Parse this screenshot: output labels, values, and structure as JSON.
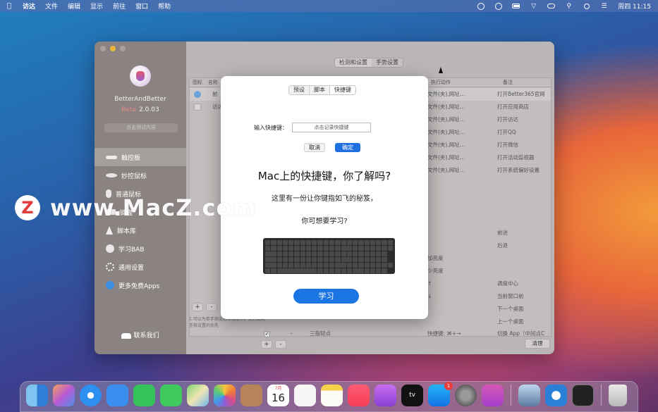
{
  "menubar": {
    "items": [
      "访达",
      "文件",
      "编辑",
      "显示",
      "前往",
      "窗口",
      "帮助"
    ],
    "clock": "周四 11:15"
  },
  "sidebar": {
    "app_name": "BetterAndBetter",
    "beta_label": "Beta",
    "version": "2.0.03",
    "faded_button": "点击测试内容",
    "items": [
      {
        "label": "触控板",
        "icon": "trackpad-icon"
      },
      {
        "label": "妙控鼠标",
        "icon": "magic-mouse-icon"
      },
      {
        "label": "普通鼠标",
        "icon": "mouse-icon"
      },
      {
        "label": "键盘",
        "icon": "keyboard-icon"
      },
      {
        "label": "脚本库",
        "icon": "script-bolt-icon"
      },
      {
        "label": "学习BAB",
        "icon": "learn-disc-icon"
      },
      {
        "label": "通用设置",
        "icon": "gear-icon"
      },
      {
        "label": "更多免费Apps",
        "icon": "app-store-icon"
      }
    ],
    "contact": "联系我们"
  },
  "content": {
    "segments": [
      "检测和设置",
      "手势设置"
    ],
    "columns": [
      "图标",
      "名称",
      "执行动作",
      "备注"
    ],
    "rows": [
      {
        "name": "前",
        "action": "文件(夹),网址...",
        "note": "打开Better365官网"
      },
      {
        "name": "访达",
        "action": "文件(夹),网址...",
        "note": "打开应用商店"
      },
      {
        "name": "",
        "action": "文件(夹),网址...",
        "note": "打开访达"
      },
      {
        "name": "",
        "action": "文件(夹),网址...",
        "note": "打开QQ"
      },
      {
        "name": "",
        "action": "文件(夹),网址...",
        "note": "打开微信"
      },
      {
        "name": "",
        "action": "文件(夹),网址...",
        "note": "打开活动监视器"
      },
      {
        "name": "",
        "action": "文件(夹),网址...",
        "note": "打开系统偏好设置"
      }
    ],
    "lower_rows": [
      {
        "action": "",
        "note": "前进"
      },
      {
        "action": "",
        "note": "后退"
      },
      {
        "action": "加亮度",
        "note": ""
      },
      {
        "action": "少亮度",
        "note": ""
      },
      {
        "action": "↑",
        "note": "调度中心"
      },
      {
        "action": "↓",
        "note": "当前窗口前"
      },
      {
        "action": "",
        "note": "下一个桌面"
      },
      {
        "action": "",
        "note": "上一个桌面"
      },
      {
        "check": "✓",
        "dash": "-",
        "name": "三指轻点",
        "action": "快捷键: ⌘+→",
        "note": "切换 App（中间点C"
      }
    ],
    "hint": "1.可以为单手指设备添加动作。优先视两手指设置的优先",
    "clear_label": "清理"
  },
  "dialog": {
    "tabs": [
      "预设",
      "脚本",
      "快捷键"
    ],
    "shortcut_label": "输入快捷键：",
    "shortcut_placeholder": "点击记录快捷键",
    "cancel_label": "取消",
    "ok_label": "确定",
    "promo_title": "Mac上的快捷键，你了解吗?",
    "promo_line1": "这里有一份让你键指如飞的秘笈，",
    "promo_line2": "你可想要学习?",
    "learn_label": "学习"
  },
  "watermark": {
    "logo": "Z",
    "text": "www.MacZ.com"
  },
  "dock": {
    "calendar_month": "7月",
    "calendar_day": "16",
    "appstore_badge": "1",
    "tv_label": "tv"
  },
  "colors": {
    "accent": "#1f6fe0",
    "learn_button": "#1b75e3",
    "beta": "#e58a85",
    "watermark_red": "#e23b3b"
  }
}
